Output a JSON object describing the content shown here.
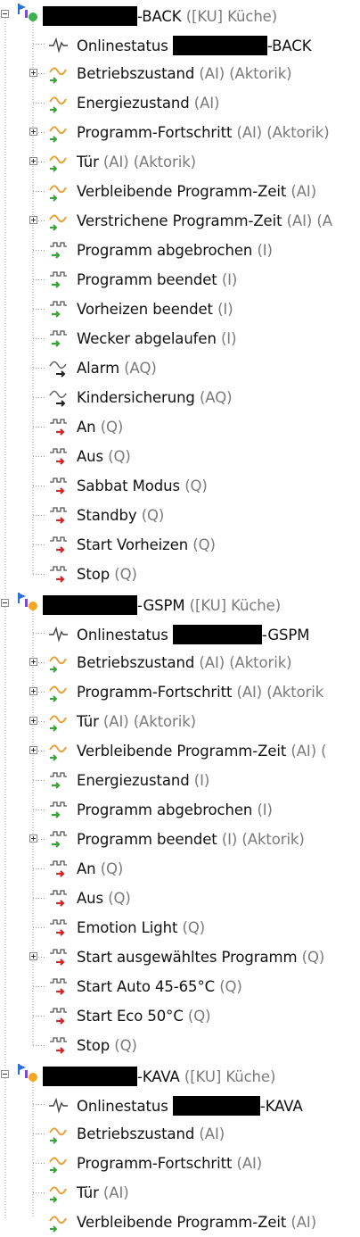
{
  "groups": [
    {
      "name_suffix": "-BACK",
      "meta": "([KU] Küche)",
      "status_dot": "#3cb34a",
      "children": [
        {
          "type": "online",
          "label": "Onlinestatus",
          "suffix": "-BACK",
          "tag": ""
        },
        {
          "type": "ai",
          "label": "Betriebszustand",
          "tag": "(AI) (Aktorik)",
          "expandable": true
        },
        {
          "type": "ai",
          "label": "Energiezustand",
          "tag": "(AI)"
        },
        {
          "type": "ai",
          "label": "Programm-Fortschritt",
          "tag": "(AI) (Aktorik)",
          "expandable": true
        },
        {
          "type": "ai",
          "label": "Tür",
          "tag": "(AI) (Aktorik)",
          "expandable": true
        },
        {
          "type": "ai",
          "label": "Verbleibende Programm-Zeit",
          "tag": "(AI)"
        },
        {
          "type": "ai",
          "label": "Verstrichene Programm-Zeit",
          "tag": "(AI) (A",
          "expandable": true
        },
        {
          "type": "i",
          "label": "Programm abgebrochen",
          "tag": "(I)"
        },
        {
          "type": "i",
          "label": "Programm beendet",
          "tag": "(I)"
        },
        {
          "type": "i",
          "label": "Vorheizen beendet",
          "tag": "(I)"
        },
        {
          "type": "i",
          "label": "Wecker abgelaufen",
          "tag": "(I)"
        },
        {
          "type": "aq",
          "label": "Alarm",
          "tag": "(AQ)"
        },
        {
          "type": "aq",
          "label": "Kindersicherung",
          "tag": "(AQ)"
        },
        {
          "type": "q",
          "label": "An",
          "tag": "(Q)"
        },
        {
          "type": "q",
          "label": "Aus",
          "tag": "(Q)"
        },
        {
          "type": "q",
          "label": "Sabbat Modus",
          "tag": "(Q)"
        },
        {
          "type": "q",
          "label": "Standby",
          "tag": "(Q)"
        },
        {
          "type": "q",
          "label": "Start Vorheizen",
          "tag": "(Q)"
        },
        {
          "type": "q",
          "label": "Stop",
          "tag": "(Q)"
        }
      ]
    },
    {
      "name_suffix": "-GSPM",
      "meta": "([KU] Küche)",
      "status_dot": "#f5a623",
      "children": [
        {
          "type": "online",
          "label": "Onlinestatus",
          "suffix": "-GSPM",
          "tag": ""
        },
        {
          "type": "ai",
          "label": "Betriebszustand",
          "tag": "(AI) (Aktorik)",
          "expandable": true
        },
        {
          "type": "ai",
          "label": "Programm-Fortschritt",
          "tag": "(AI) (Aktorik",
          "expandable": true
        },
        {
          "type": "ai",
          "label": "Tür",
          "tag": "(AI) (Aktorik)",
          "expandable": true
        },
        {
          "type": "ai",
          "label": "Verbleibende Programm-Zeit",
          "tag": "(AI) (",
          "expandable": true
        },
        {
          "type": "i",
          "label": "Energiezustand",
          "tag": "(I)"
        },
        {
          "type": "i",
          "label": "Programm abgebrochen",
          "tag": "(I)"
        },
        {
          "type": "i",
          "label": "Programm beendet",
          "tag": "(I) (Aktorik)",
          "expandable": true
        },
        {
          "type": "q",
          "label": "An",
          "tag": "(Q)"
        },
        {
          "type": "q",
          "label": "Aus",
          "tag": "(Q)"
        },
        {
          "type": "q",
          "label": "Emotion Light",
          "tag": "(Q)"
        },
        {
          "type": "q",
          "label": "Start ausgewähltes Programm",
          "tag": "(Q)",
          "expandable": true
        },
        {
          "type": "q",
          "label": "Start Auto 45-65°C",
          "tag": "(Q)"
        },
        {
          "type": "q",
          "label": "Start Eco 50°C",
          "tag": "(Q)"
        },
        {
          "type": "q",
          "label": "Stop",
          "tag": "(Q)"
        }
      ]
    },
    {
      "name_suffix": "-KAVA",
      "meta": "([KU] Küche)",
      "status_dot": "#f5a623",
      "children": [
        {
          "type": "online",
          "label": "Onlinestatus",
          "suffix": "-KAVA",
          "tag": ""
        },
        {
          "type": "ai",
          "label": "Betriebszustand",
          "tag": "(AI)"
        },
        {
          "type": "ai",
          "label": "Programm-Fortschritt",
          "tag": "(AI)"
        },
        {
          "type": "ai",
          "label": "Tür",
          "tag": "(AI)"
        },
        {
          "type": "ai",
          "label": "Verbleibende Programm-Zeit",
          "tag": "(AI)"
        }
      ]
    }
  ],
  "colors": {
    "tag_text": "#7a7a7a",
    "arrow_green": "#3aa33a",
    "arrow_red": "#d0282d",
    "arrow_black": "#222222",
    "wave_orange": "#e8a23a"
  }
}
